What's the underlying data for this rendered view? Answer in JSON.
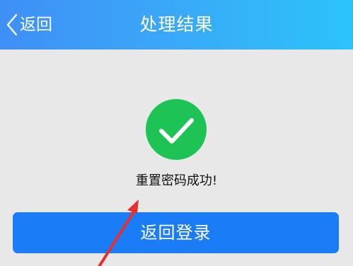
{
  "header": {
    "back_label": "返回",
    "title": "处理结果",
    "gradient_start": "#3f8ff6",
    "gradient_end": "#2cc3fa"
  },
  "result": {
    "icon": "check-circle-icon",
    "icon_color": "#1dc455",
    "message": "重置密码成功!"
  },
  "actions": {
    "return_login_label": "返回登录",
    "button_color": "#1a7cf6"
  },
  "annotation": {
    "type": "red-arrow",
    "color": "#e53030"
  }
}
